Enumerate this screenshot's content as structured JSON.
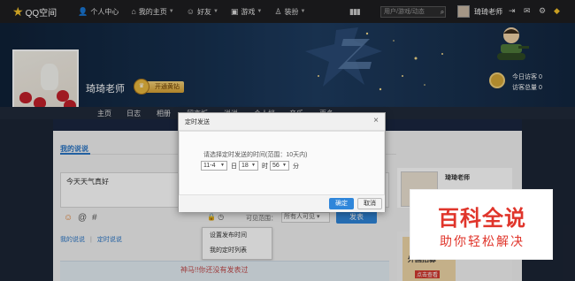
{
  "topbar": {
    "logo": "QQ空间",
    "items": [
      {
        "label": "个人中心"
      },
      {
        "label": "我的主页",
        "caret": true
      },
      {
        "label": "好友",
        "caret": true
      },
      {
        "label": "游戏",
        "caret": true
      },
      {
        "label": "装扮",
        "caret": true
      }
    ],
    "search_placeholder": "用户/游戏/动态",
    "user": "琦琦老师"
  },
  "profile": {
    "name": "琦琦老师",
    "vip_button": "开通黄钻",
    "visits_today": "今日访客 0",
    "visits_total": "访客总量 0"
  },
  "nav": [
    "主页",
    "日志",
    "相册",
    "留言板",
    "说说",
    "个人档",
    "音乐",
    "更多"
  ],
  "feed": {
    "section_title": "我的说说",
    "compose_text": "今天天气真好",
    "visibility_label": "可见范围：",
    "visibility_value": "所有人可见",
    "publish": "发表",
    "tabs": [
      "我的说说",
      "定时说说"
    ],
    "dropdown": [
      "设置发布时间",
      "我的定时列表"
    ]
  },
  "sidebar": {
    "name": "琦琦老师",
    "ad_text": "外国招募",
    "ad_button": "点击查看"
  },
  "dialog": {
    "title": "定时发送",
    "prompt": "请选择定时发送的时间(范围：10天内)",
    "date": "11-4",
    "date_unit": "日",
    "hour": "18",
    "hour_unit": "时",
    "minute": "56",
    "minute_unit": "分",
    "ok": "确定",
    "cancel": "取消"
  },
  "watermark": {
    "main": "百科全说",
    "sub": "助你轻松解决"
  },
  "comic_text": "神马!!你还没有发表过"
}
